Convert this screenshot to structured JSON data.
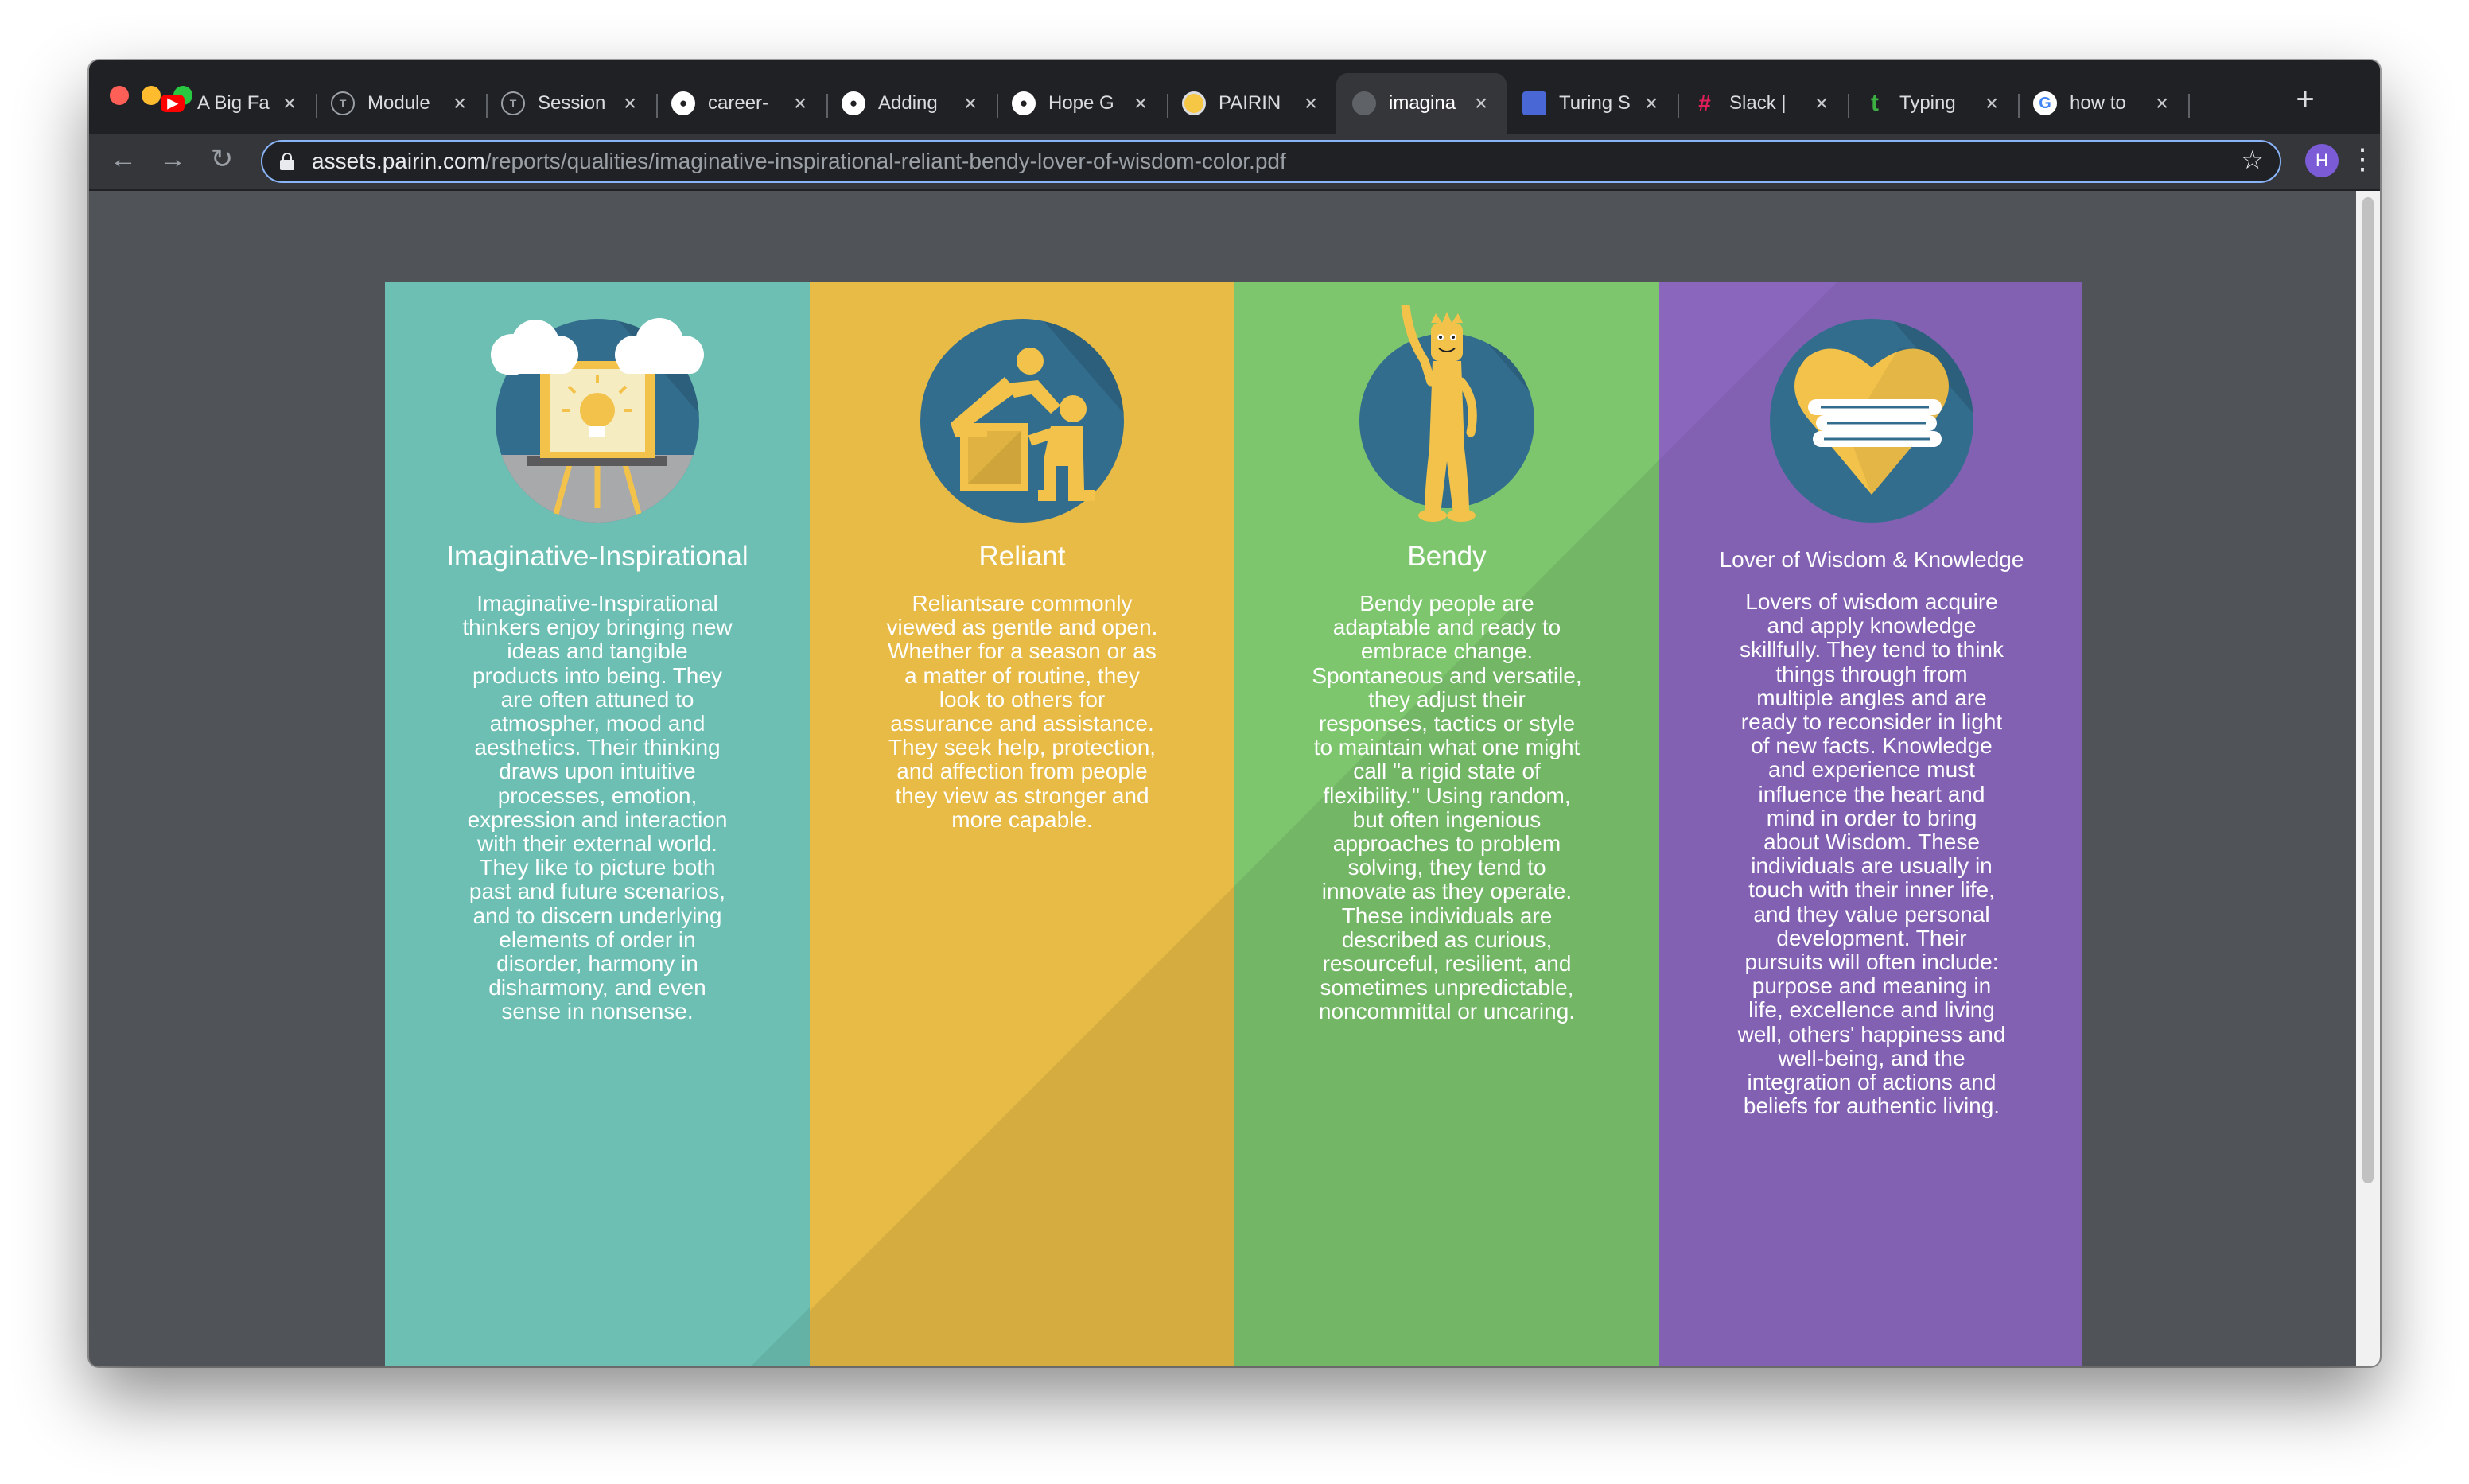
{
  "browser": {
    "tabs": [
      {
        "title": "A Big Fa",
        "favicon": "youtube-icon",
        "color": "#ff0000",
        "active": false
      },
      {
        "title": "Module",
        "favicon": "turing-icon",
        "color": "#9aa0a6",
        "active": false
      },
      {
        "title": "Session",
        "favicon": "turing-icon",
        "color": "#9aa0a6",
        "active": false
      },
      {
        "title": "career-",
        "favicon": "github-icon",
        "color": "#ffffff",
        "active": false
      },
      {
        "title": "Adding",
        "favicon": "github-icon",
        "color": "#ffffff",
        "active": false
      },
      {
        "title": "Hope G",
        "favicon": "github-icon",
        "color": "#ffffff",
        "active": false
      },
      {
        "title": "PAIRIN",
        "favicon": "pairin-icon",
        "color": "#f6c744",
        "active": false
      },
      {
        "title": "imagina",
        "favicon": "globe-icon",
        "color": "#5f6368",
        "active": true
      },
      {
        "title": "Turing S",
        "favicon": "turing-calendar-icon",
        "color": "#4a67d6",
        "active": false
      },
      {
        "title": "Slack |",
        "favicon": "slack-icon",
        "color": "#e01e5a",
        "active": false
      },
      {
        "title": "Typing",
        "favicon": "typing-icon",
        "color": "#3cb043",
        "active": false
      },
      {
        "title": "how to",
        "favicon": "google-icon",
        "color": "#4285f4",
        "active": false
      }
    ],
    "url_host": "assets.pairin.com",
    "url_path": "/reports/qualities/imaginative-inspirational-reliant-bendy-lover-of-wisdom-color.pdf",
    "avatar_letter": "H"
  },
  "columns": [
    {
      "title": "Imaginative-Inspirational",
      "icon": "easel-lightbulb-icon",
      "color": "#6cbfb2",
      "body": "Imaginative-Inspirational thinkers enjoy bringing new ideas and tangible products into being. They are often attuned to atmospher, mood and aesthetics. Their thinking draws upon intuitive processes, emotion, expression and interaction with their external world. They like to picture both past and future scenarios, and to discern underlying elements of order in disorder, harmony in disharmony, and even sense in nonsense."
    },
    {
      "title": "Reliant",
      "icon": "helping-figures-icon",
      "color": "#e7bb45",
      "body": "Reliantsare commonly viewed as gentle and open. Whether for a season or as a matter of routine, they look to others for assurance and assistance. They seek help, protection, and affection from people they view as stronger and more capable."
    },
    {
      "title": "Bendy",
      "icon": "bendy-figure-icon",
      "color": "#7dc66e",
      "body": "Bendy people are adaptable and ready to embrace change. Spontaneous and versatile, they adjust their responses, tactics or style to maintain what one might call \"a rigid state of flexibility.\" Using random, but often ingenious approaches to problem solving, they tend to innovate as they operate. These individuals are described as curious, resourceful, resilient, and sometimes unpredictable, noncommittal or uncaring."
    },
    {
      "title": "Lover of Wisdom & Knowledge",
      "icon": "heart-books-icon",
      "color": "#8a67bd",
      "body": "Lovers of wisdom acquire and apply knowledge skillfully. They tend to think things through from multiple angles and are ready to reconsider in light of new facts. Knowledge and experience must influence the heart and mind in order to bring about Wisdom. These individuals are usually in touch with their inner life, and they value personal development. Their pursuits will often include: purpose and meaning in life, excellence and living well, others' happiness and well-being, and the integration of actions and beliefs for authentic living."
    }
  ]
}
